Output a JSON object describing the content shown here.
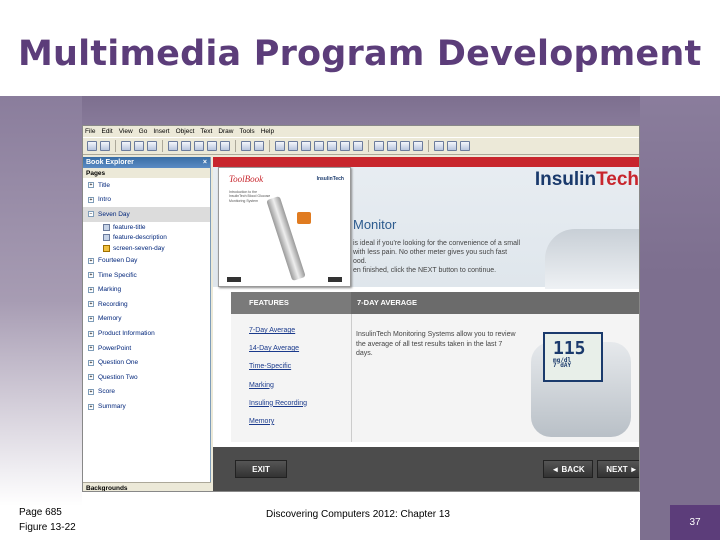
{
  "slide": {
    "title": "Multimedia Program Development",
    "footer_left_line1": "Page 685",
    "footer_left_line2": "Figure 13-22",
    "footer_center": "Discovering Computers 2012: Chapter 13",
    "page_number": "37"
  },
  "colors": {
    "title": "#5c3d7a",
    "band": "#7d6f8f",
    "page_number_bg": "#5c3d7a",
    "brand_red": "#c8262d",
    "brand_blue": "#1a3a6c"
  },
  "menubar": {
    "items": [
      "File",
      "Edit",
      "View",
      "Go",
      "Insert",
      "Object",
      "Text",
      "Draw",
      "Tools",
      "Help"
    ]
  },
  "explorer": {
    "title": "Book Explorer",
    "close_icon": "×",
    "pages_label": "Pages",
    "items": [
      {
        "label": "Title",
        "state": "+"
      },
      {
        "label": "Intro",
        "state": "+"
      },
      {
        "label": "Seven Day",
        "state": "−"
      },
      {
        "label": "Fourteen Day",
        "state": "+"
      },
      {
        "label": "Time Specific",
        "state": "+"
      },
      {
        "label": "Marking",
        "state": "+"
      },
      {
        "label": "Recording",
        "state": "+"
      },
      {
        "label": "Memory",
        "state": "+"
      },
      {
        "label": "Product Information",
        "state": "+"
      },
      {
        "label": "PowerPoint",
        "state": "+"
      },
      {
        "label": "Question One",
        "state": "+"
      },
      {
        "label": "Question Two",
        "state": "+"
      },
      {
        "label": "Score",
        "state": "+"
      },
      {
        "label": "Summary",
        "state": "+"
      }
    ],
    "children": [
      "feature-title",
      "feature-description",
      "screen-seven-day"
    ],
    "backgrounds_label": "Backgrounds"
  },
  "app": {
    "brand_part1": "Insulin",
    "brand_part2": "Tech",
    "heading": "Monitor",
    "intro_line1": "is ideal if you're looking for the convenience of a small",
    "intro_line2": "with less pain. No other meter gives you such fast",
    "intro_line3": "ood.",
    "intro_line4": "en finished, click the NEXT button to continue.",
    "thumb_title": "ToolBook",
    "thumb_brand": "InsulinTech",
    "thumb_text": "Introduction to the InsulinTech Blood Glucose Monitoring System",
    "features_header": "FEATURES",
    "average_header": "7-DAY AVERAGE",
    "features": [
      "7-Day Average",
      "14-Day Average",
      "Time-Specific",
      "Marking",
      "Insuling Recording",
      "Memory"
    ],
    "description": "InsulinTech Monitoring Systems allow you to review the average of all test results taken in the last 7 days.",
    "meter_reading": "115",
    "meter_unit": "mg/dl",
    "meter_sub": "7 dAY",
    "exit_label": "EXIT",
    "back_label": "◄ BACK",
    "next_label": "NEXT ►"
  }
}
